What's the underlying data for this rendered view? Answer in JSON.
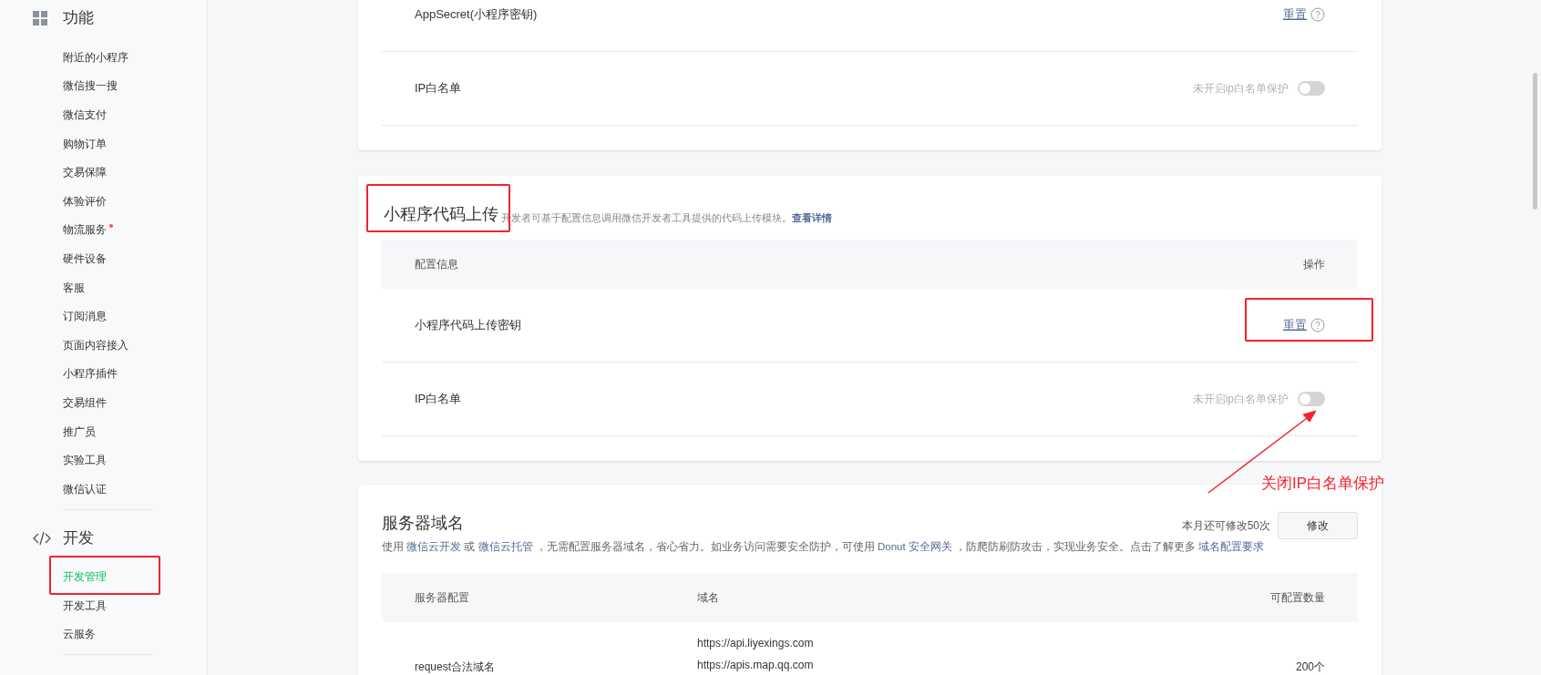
{
  "sidebar": {
    "sections": [
      {
        "title": "功能",
        "items": [
          {
            "label": "附近的小程序",
            "selected": false,
            "dot": false
          },
          {
            "label": "微信搜一搜",
            "selected": false,
            "dot": false
          },
          {
            "label": "微信支付",
            "selected": false,
            "dot": false
          },
          {
            "label": "购物订单",
            "selected": false,
            "dot": false
          },
          {
            "label": "交易保障",
            "selected": false,
            "dot": false
          },
          {
            "label": "体验评价",
            "selected": false,
            "dot": false
          },
          {
            "label": "物流服务",
            "selected": false,
            "dot": true
          },
          {
            "label": "硬件设备",
            "selected": false,
            "dot": false
          },
          {
            "label": "客服",
            "selected": false,
            "dot": false
          },
          {
            "label": "订阅消息",
            "selected": false,
            "dot": false
          },
          {
            "label": "页面内容接入",
            "selected": false,
            "dot": false
          },
          {
            "label": "小程序插件",
            "selected": false,
            "dot": false
          },
          {
            "label": "交易组件",
            "selected": false,
            "dot": false
          },
          {
            "label": "推广员",
            "selected": false,
            "dot": false
          },
          {
            "label": "实验工具",
            "selected": false,
            "dot": false
          },
          {
            "label": "微信认证",
            "selected": false,
            "dot": false
          }
        ]
      },
      {
        "title": "开发",
        "items": [
          {
            "label": "开发管理",
            "selected": true,
            "dot": false
          },
          {
            "label": "开发工具",
            "selected": false,
            "dot": false
          },
          {
            "label": "云服务",
            "selected": false,
            "dot": false
          }
        ]
      }
    ]
  },
  "secret_card": {
    "rows": [
      {
        "kind": "action",
        "label": "AppSecret(小程序密钥)",
        "action": "重置"
      },
      {
        "kind": "toggle",
        "label": "IP白名单",
        "status": "未开启ip白名单保护",
        "on": false
      }
    ]
  },
  "upload_card": {
    "title": "小程序代码上传",
    "description": "开发者可基于配置信息调用微信开发者工具提供的代码上传模块。",
    "link": "查看详情",
    "columns": [
      "配置信息",
      "操作"
    ],
    "rows": [
      {
        "kind": "action",
        "label": "小程序代码上传密钥",
        "action": "重置"
      },
      {
        "kind": "toggle",
        "label": "IP白名单",
        "status": "未开启ip白名单保护",
        "on": false
      }
    ]
  },
  "domain_card": {
    "title": "服务器域名",
    "quota": "本月还可修改50次",
    "button": "修改",
    "description": [
      {
        "text": "使用 ",
        "link": false
      },
      {
        "text": "微信云开发",
        "link": true
      },
      {
        "text": " 或 ",
        "link": false
      },
      {
        "text": "微信云托管",
        "link": true
      },
      {
        "text": " ，无需配置服务器域名，省心省力。如业务访问需要安全防护，可使用 ",
        "link": false
      },
      {
        "text": "Donut 安全网关",
        "link": true
      },
      {
        "text": " ，防爬防刷防攻击，实现业务安全。点击了解更多 ",
        "link": false
      },
      {
        "text": "域名配置要求",
        "link": true
      }
    ],
    "columns": [
      "服务器配置",
      "域名",
      "可配置数量"
    ],
    "rows": [
      {
        "config": "request合法域名",
        "domains": [
          "https://api.liyexings.com",
          "https://apis.map.qq.com"
        ],
        "count": "200个"
      }
    ]
  },
  "annotation": {
    "label": "关闭IP白名单保护"
  }
}
